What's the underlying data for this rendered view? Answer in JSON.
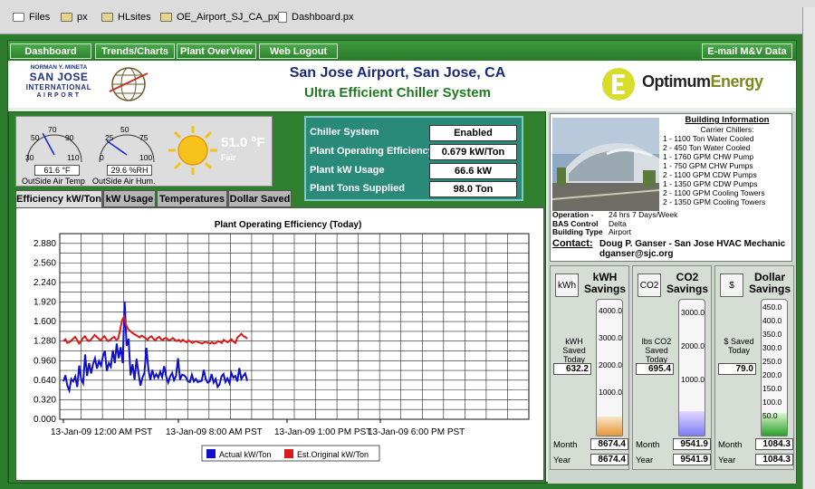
{
  "tabs": [
    {
      "label": "Files",
      "icon": "list-icon"
    },
    {
      "label": "px",
      "icon": "folder-icon"
    },
    {
      "label": "HLsites",
      "icon": "folder-icon"
    },
    {
      "label": "OE_Airport_SJ_CA_px",
      "icon": "folder-icon"
    },
    {
      "label": "Dashboard.px",
      "icon": "document-icon"
    }
  ],
  "nav": {
    "dashboard": "Dashboard",
    "trends": "Trends/Charts",
    "plant": "Plant OverView",
    "logout": "Web Logout",
    "email": "E-mail M&V Data"
  },
  "sj_logo": {
    "line1": "NORMAN Y. MINETA",
    "line2": "SAN JOSE",
    "line3": "INTERNATIONAL",
    "line4": "AIRPORT"
  },
  "header": {
    "title": "San Jose Airport, San Jose, CA",
    "subtitle": "Ultra Efficient Chiller System",
    "brand_optimum": "Optimum",
    "brand_energy": "Energy"
  },
  "weather": {
    "temp_gauge": {
      "ticks": [
        "50",
        "70",
        "90",
        "30",
        "110"
      ],
      "reading": "61.6 °F",
      "label": "OutSide Air Temp",
      "value": 61.6
    },
    "hum_gauge": {
      "ticks": [
        "25",
        "50",
        "75",
        "0",
        "100"
      ],
      "reading": "29.6 %RH",
      "label": "OutSide Air Hum.",
      "value": 29.6
    },
    "temperature": "51.0 °F",
    "condition": "Fair"
  },
  "status": [
    {
      "label": "Chiller System",
      "value": "Enabled"
    },
    {
      "label": "Plant Operating Efficiency",
      "value": "0.679 kW/Ton"
    },
    {
      "label": "Plant kW Usage",
      "value": "66.6 kW"
    },
    {
      "label": "Plant Tons Supplied",
      "value": "98.0 Ton"
    }
  ],
  "chart_tabs": [
    "Efficiency kW/Ton",
    "kW Usage",
    "Temperatures",
    "Dollar Saved"
  ],
  "chart_data": {
    "type": "line",
    "title": "Plant Operating Efficiency (Today)",
    "ylim": [
      0,
      3.04
    ],
    "yticks": [
      "0.000",
      "0.320",
      "0.640",
      "0.960",
      "1.280",
      "1.600",
      "1.920",
      "2.240",
      "2.560",
      "2.880"
    ],
    "xticks": [
      "13-Jan-09 12:00 AM PST",
      "13-Jan-09 8:00 AM PST",
      "13-Jan-09 1:00 PM PST",
      "13-Jan-09 6:00 PM PST"
    ],
    "grid": true,
    "legend": "bottom",
    "series": [
      {
        "name": "Actual kW/Ton",
        "color": "#1010cc",
        "values": [
          0.62,
          0.72,
          0.55,
          0.47,
          0.66,
          0.62,
          0.7,
          0.53,
          0.88,
          0.66,
          0.59,
          1.06,
          0.71,
          0.92,
          0.75,
          0.9,
          1.0,
          0.83,
          0.95,
          0.88,
          1.03,
          1.12,
          0.79,
          0.92,
          0.86,
          1.13,
          0.92,
          1.24,
          1.0,
          1.18,
          0.92,
          1.93,
          1.2,
          1.32,
          0.72,
          0.9,
          0.65,
          0.99,
          0.76,
          0.55,
          0.68,
          0.76,
          1.17,
          0.82,
          0.64,
          0.81,
          0.68,
          0.74,
          0.68,
          0.78,
          0.69,
          0.87,
          0.7,
          0.6,
          0.7,
          0.76,
          0.64,
          0.71,
          1.0,
          0.65,
          0.73,
          0.72,
          0.69,
          0.62,
          0.61,
          0.73,
          0.62,
          0.66,
          0.61,
          0.62,
          0.63,
          0.81,
          0.66,
          0.6,
          0.62,
          0.74,
          0.6,
          0.66,
          0.53,
          0.57,
          0.7,
          0.74,
          0.61,
          0.67,
          0.59,
          0.76,
          0.68,
          0.71,
          0.62,
          0.84,
          0.66,
          0.71,
          0.75,
          0.63
        ]
      },
      {
        "name": "Est.Original kW/Ton",
        "color": "#dd1a1a",
        "values": [
          1.28,
          1.31,
          1.25,
          1.26,
          1.29,
          1.32,
          1.35,
          1.3,
          1.24,
          1.27,
          1.33,
          1.36,
          1.31,
          1.28,
          1.3,
          1.34,
          1.38,
          1.35,
          1.32,
          1.29,
          1.33,
          1.36,
          1.31,
          1.28,
          1.3,
          1.33,
          1.35,
          1.3,
          1.32,
          1.46,
          1.62,
          1.68,
          1.55,
          1.48,
          1.45,
          1.42,
          1.4,
          1.38,
          1.36,
          1.34,
          1.37,
          1.35,
          1.33,
          1.3,
          1.34,
          1.36,
          1.32,
          1.29,
          1.33,
          1.35,
          1.31,
          1.3,
          1.33,
          1.32,
          1.29,
          1.31,
          1.33,
          1.3,
          1.28,
          1.3,
          1.27,
          1.3,
          1.28,
          1.26,
          1.29,
          1.27,
          1.25,
          1.27,
          1.28,
          1.26,
          1.25,
          1.24,
          1.26,
          1.27,
          1.25,
          1.24,
          1.26,
          1.24,
          1.25,
          1.28,
          1.27,
          1.25,
          1.3,
          1.28,
          1.26,
          1.29,
          1.31,
          1.27,
          1.25,
          1.34,
          1.37,
          1.4,
          1.36,
          1.35,
          1.32
        ]
      }
    ]
  },
  "building": {
    "title": "Building Information",
    "chillers_header": "Carrier Chillers:",
    "lines": [
      "1 - 1100 Ton Water Cooled",
      "2 - 450 Ton Water Cooled",
      "1 - 1760 GPM CHW Pump",
      "1 - 750 GPM CHW Pumps",
      "2 - 1100 GPM CDW Pumps",
      "1 - 1350 GPM CDW Pumps",
      "2 - 1100 GPM Cooling Towers",
      "2 - 1350 GPM Cooling Towers"
    ],
    "ops": [
      {
        "label": "Operation -",
        "value": "24 hrs 7 Days/Week"
      },
      {
        "label": "BAS Control",
        "value": "Delta"
      },
      {
        "label": "Building Type",
        "value": "Airport"
      }
    ],
    "contact_label": "Contact:",
    "contact_name": "Doug P. Ganser - San Jose HVAC Mechanic",
    "contact_email": "dganser@sjc.org"
  },
  "savings": [
    {
      "icon": "kwh-icon",
      "icon_text": "kWh",
      "title": "kWH Savings",
      "today_label": "kWH Saved Today",
      "today": "632.2",
      "ticks": [
        "4000.0",
        "3000.0",
        "2000.0",
        "1000.0"
      ],
      "fill_fraction": 0.14,
      "fill_top": "#f7e6c9",
      "fill_bottom": "#e8963a",
      "month_label": "Month",
      "month": "8674.4",
      "year_label": "Year",
      "year": "8674.4"
    },
    {
      "icon": "co2-icon",
      "icon_text": "CO2",
      "title": "CO2 Savings",
      "today_label": "lbs CO2 Saved Today",
      "today": "695.4",
      "ticks": [
        "3000.0",
        "2000.0",
        "1000.0"
      ],
      "fill_fraction": 0.18,
      "fill_top": "#e3d9ff",
      "fill_bottom": "#7d7df5",
      "month_label": "Month",
      "month": "9541.9",
      "year_label": "Year",
      "year": "9541.9"
    },
    {
      "icon": "dollar-icon",
      "icon_text": "$",
      "title": "Dollar Savings",
      "today_label": "$ Saved Today",
      "today": "79.0",
      "ticks": [
        "450.0",
        "400.0",
        "350.0",
        "300.0",
        "250.0",
        "200.0",
        "150.0",
        "100.0",
        "50.0"
      ],
      "fill_fraction": 0.17,
      "fill_top": "#d9f5d0",
      "fill_bottom": "#2aa02a",
      "month_label": "Month",
      "month": "1084.3",
      "year_label": "Year",
      "year": "1084.3"
    }
  ]
}
